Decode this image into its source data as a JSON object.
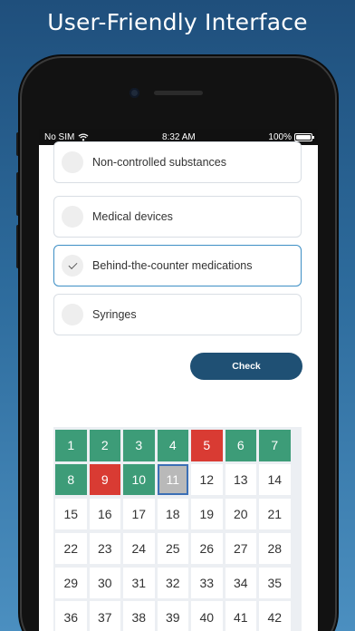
{
  "headline": "User-Friendly Interface",
  "status_bar": {
    "carrier": "No SIM",
    "time": "8:32 AM",
    "battery": "100%"
  },
  "options": [
    {
      "label": "Non-controlled substances",
      "selected": false
    },
    {
      "label": "Medical devices",
      "selected": false
    },
    {
      "label": "Behind-the-counter medications",
      "selected": true
    },
    {
      "label": "Syringes",
      "selected": false
    }
  ],
  "check_button": "Check",
  "question_grid": {
    "numbers": [
      "1",
      "2",
      "3",
      "4",
      "5",
      "6",
      "7",
      "8",
      "9",
      "10",
      "11",
      "12",
      "13",
      "14",
      "15",
      "16",
      "17",
      "18",
      "19",
      "20",
      "21",
      "22",
      "23",
      "24",
      "25",
      "26",
      "27",
      "28",
      "29",
      "30",
      "31",
      "32",
      "33",
      "34",
      "35",
      "36",
      "37",
      "38",
      "39",
      "40",
      "41",
      "42"
    ],
    "correct": [
      "1",
      "2",
      "3",
      "4",
      "6",
      "7",
      "8",
      "10"
    ],
    "wrong": [
      "5",
      "9"
    ],
    "current": "11"
  },
  "colors": {
    "correct": "#3d9c78",
    "wrong": "#d93b33",
    "current": "#b9b9b9",
    "accent": "#3d8fc5",
    "check_button": "#1f5074"
  }
}
